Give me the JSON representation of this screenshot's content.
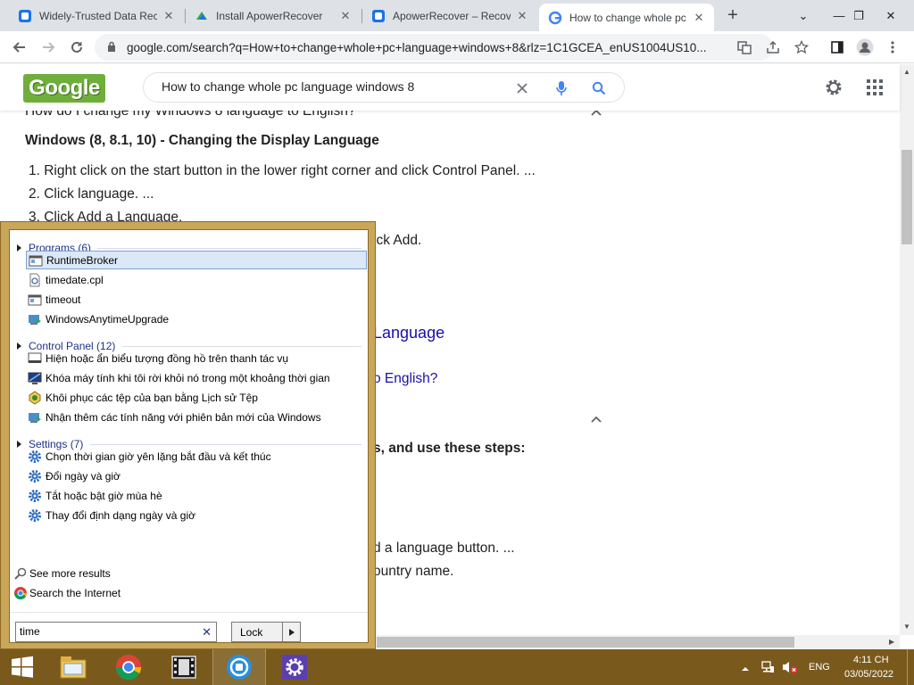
{
  "browser": {
    "tabs": [
      {
        "title": "Widely-Trusted Data Recove",
        "favicon": "apowersoft-icon"
      },
      {
        "title": "Install ApowerRecover",
        "favicon": "windows-store-icon"
      },
      {
        "title": "ApowerRecover – Recove",
        "favicon": "apowersoft-icon"
      },
      {
        "title": "How to change whole pc lan",
        "favicon": "google-icon"
      }
    ],
    "new_tab_symbol": "+",
    "window_controls": {
      "dropdown": "⌄",
      "minimize": "—",
      "restore": "❐",
      "close": "✕"
    },
    "url": "google.com/search?q=How+to+change+whole+pc+language+windows+8&rlz=1C1GCEA_enUS1004US10..."
  },
  "google": {
    "logo_text": "Google",
    "search_value": "How to change whole pc language windows 8"
  },
  "page": {
    "faq_question": "How do I change my Windows 8 language to English?",
    "section_heading": "Windows (8, 8.1, 10) - Changing the Display Language",
    "steps": [
      "1. Right click on the start button in the lower right corner and click Control Panel. ...",
      "2. Click language. ...",
      "3. Click Add a Language."
    ],
    "partial_texts": {
      "click_add": "ick Add.",
      "language_link": "Language",
      "english_link": "o English?",
      "steps_heading": "s, and use these steps:",
      "language_button": "d a language button. ...",
      "country_name": "ountry name."
    }
  },
  "start_menu": {
    "groups": [
      {
        "header": "Programs (6)",
        "items": [
          {
            "label": "RuntimeBroker",
            "icon": "app-window-icon"
          },
          {
            "label": "timedate.cpl",
            "icon": "cpl-file-icon"
          },
          {
            "label": "timeout",
            "icon": "app-window-icon"
          },
          {
            "label": "WindowsAnytimeUpgrade",
            "icon": "windows-upgrade-icon"
          }
        ]
      },
      {
        "header": "Control Panel (12)",
        "items": [
          {
            "label": "Hiện hoặc ẩn biểu tượng đồng hồ trên thanh tác vụ",
            "icon": "taskbar-icon"
          },
          {
            "label": "Khóa máy tính khi tôi rời khỏi nó trong một khoảng thời gian",
            "icon": "monitor-icon"
          },
          {
            "label": "Khôi phục các tệp của bạn bằng Lịch sử Tệp",
            "icon": "file-history-icon"
          },
          {
            "label": "Nhận thêm các tính năng với phiên bản mới của Windows",
            "icon": "windows-upgrade-icon"
          }
        ]
      },
      {
        "header": "Settings (7)",
        "items": [
          {
            "label": "Chọn thời gian giờ yên lặng bắt đầu và kết thúc",
            "icon": "gear-icon"
          },
          {
            "label": "Đổi ngày và giờ",
            "icon": "gear-icon"
          },
          {
            "label": "Tắt hoặc bật giờ mùa hè",
            "icon": "gear-icon"
          },
          {
            "label": "Thay đổi định dạng ngày và giờ",
            "icon": "gear-icon"
          }
        ]
      }
    ],
    "see_more": "See more results",
    "search_internet": "Search the Internet",
    "search_value": "time",
    "lock_label": "Lock"
  },
  "taskbar": {
    "apps": [
      "windows-explorer-icon",
      "chrome-icon",
      "video-editor-icon",
      "apowerrecover-icon",
      "settings-app-icon"
    ],
    "language": "ENG",
    "time": "4:11 CH",
    "date": "03/05/2022"
  },
  "colors": {
    "start_menu_border": "#c9a75a",
    "taskbar": "#7a5a1c",
    "link": "#1a0dab"
  }
}
